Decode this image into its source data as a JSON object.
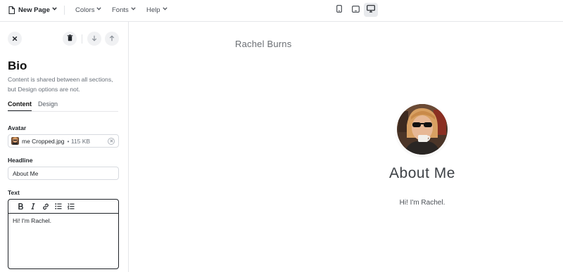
{
  "topbar": {
    "page_menu_label": "New Page",
    "colors_label": "Colors",
    "fonts_label": "Fonts",
    "help_label": "Help",
    "devices": [
      "mobile",
      "tablet",
      "desktop"
    ],
    "active_device": "desktop"
  },
  "sidebar": {
    "title": "Bio",
    "description": "Content is shared between all sections, but Design options are not.",
    "tabs": [
      {
        "label": "Content",
        "active": true
      },
      {
        "label": "Design",
        "active": false
      }
    ],
    "avatar": {
      "label": "Avatar",
      "file_name": "me Cropped.jpg",
      "file_size": "• 115 KB"
    },
    "headline": {
      "label": "Headline",
      "value": "About Me"
    },
    "text": {
      "label": "Text",
      "value": "Hi! I'm Rachel."
    }
  },
  "preview": {
    "site_name": "Rachel Burns",
    "heading": "About Me",
    "body": "Hi! I'm Rachel."
  },
  "colors": {
    "active_device_bg": "#e8eaed",
    "text_primary": "#1f2328",
    "muted": "#6a717a"
  }
}
